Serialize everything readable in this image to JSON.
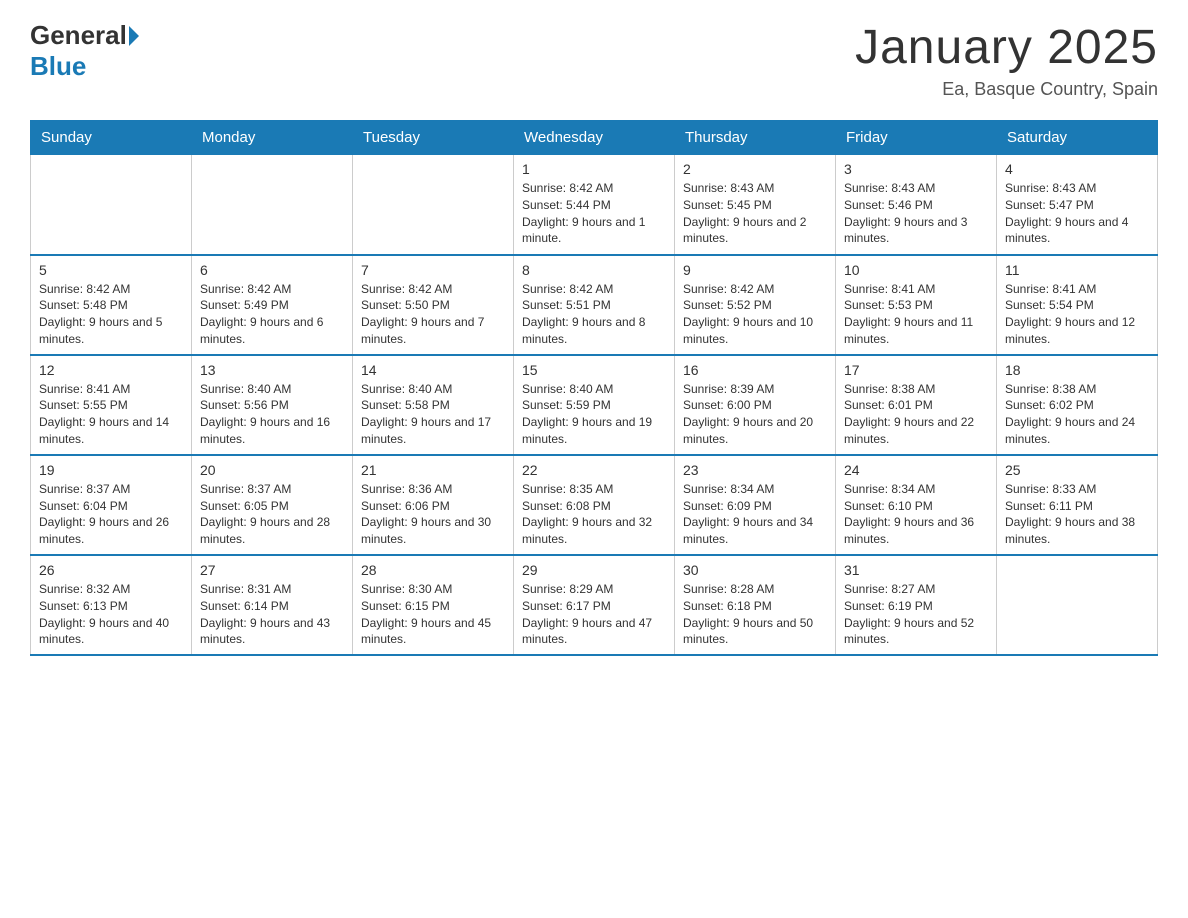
{
  "header": {
    "logo_general": "General",
    "logo_blue": "Blue",
    "title": "January 2025",
    "subtitle": "Ea, Basque Country, Spain"
  },
  "days_of_week": [
    "Sunday",
    "Monday",
    "Tuesday",
    "Wednesday",
    "Thursday",
    "Friday",
    "Saturday"
  ],
  "weeks": [
    [
      {
        "day": "",
        "info": ""
      },
      {
        "day": "",
        "info": ""
      },
      {
        "day": "",
        "info": ""
      },
      {
        "day": "1",
        "info": "Sunrise: 8:42 AM\nSunset: 5:44 PM\nDaylight: 9 hours and 1 minute."
      },
      {
        "day": "2",
        "info": "Sunrise: 8:43 AM\nSunset: 5:45 PM\nDaylight: 9 hours and 2 minutes."
      },
      {
        "day": "3",
        "info": "Sunrise: 8:43 AM\nSunset: 5:46 PM\nDaylight: 9 hours and 3 minutes."
      },
      {
        "day": "4",
        "info": "Sunrise: 8:43 AM\nSunset: 5:47 PM\nDaylight: 9 hours and 4 minutes."
      }
    ],
    [
      {
        "day": "5",
        "info": "Sunrise: 8:42 AM\nSunset: 5:48 PM\nDaylight: 9 hours and 5 minutes."
      },
      {
        "day": "6",
        "info": "Sunrise: 8:42 AM\nSunset: 5:49 PM\nDaylight: 9 hours and 6 minutes."
      },
      {
        "day": "7",
        "info": "Sunrise: 8:42 AM\nSunset: 5:50 PM\nDaylight: 9 hours and 7 minutes."
      },
      {
        "day": "8",
        "info": "Sunrise: 8:42 AM\nSunset: 5:51 PM\nDaylight: 9 hours and 8 minutes."
      },
      {
        "day": "9",
        "info": "Sunrise: 8:42 AM\nSunset: 5:52 PM\nDaylight: 9 hours and 10 minutes."
      },
      {
        "day": "10",
        "info": "Sunrise: 8:41 AM\nSunset: 5:53 PM\nDaylight: 9 hours and 11 minutes."
      },
      {
        "day": "11",
        "info": "Sunrise: 8:41 AM\nSunset: 5:54 PM\nDaylight: 9 hours and 12 minutes."
      }
    ],
    [
      {
        "day": "12",
        "info": "Sunrise: 8:41 AM\nSunset: 5:55 PM\nDaylight: 9 hours and 14 minutes."
      },
      {
        "day": "13",
        "info": "Sunrise: 8:40 AM\nSunset: 5:56 PM\nDaylight: 9 hours and 16 minutes."
      },
      {
        "day": "14",
        "info": "Sunrise: 8:40 AM\nSunset: 5:58 PM\nDaylight: 9 hours and 17 minutes."
      },
      {
        "day": "15",
        "info": "Sunrise: 8:40 AM\nSunset: 5:59 PM\nDaylight: 9 hours and 19 minutes."
      },
      {
        "day": "16",
        "info": "Sunrise: 8:39 AM\nSunset: 6:00 PM\nDaylight: 9 hours and 20 minutes."
      },
      {
        "day": "17",
        "info": "Sunrise: 8:38 AM\nSunset: 6:01 PM\nDaylight: 9 hours and 22 minutes."
      },
      {
        "day": "18",
        "info": "Sunrise: 8:38 AM\nSunset: 6:02 PM\nDaylight: 9 hours and 24 minutes."
      }
    ],
    [
      {
        "day": "19",
        "info": "Sunrise: 8:37 AM\nSunset: 6:04 PM\nDaylight: 9 hours and 26 minutes."
      },
      {
        "day": "20",
        "info": "Sunrise: 8:37 AM\nSunset: 6:05 PM\nDaylight: 9 hours and 28 minutes."
      },
      {
        "day": "21",
        "info": "Sunrise: 8:36 AM\nSunset: 6:06 PM\nDaylight: 9 hours and 30 minutes."
      },
      {
        "day": "22",
        "info": "Sunrise: 8:35 AM\nSunset: 6:08 PM\nDaylight: 9 hours and 32 minutes."
      },
      {
        "day": "23",
        "info": "Sunrise: 8:34 AM\nSunset: 6:09 PM\nDaylight: 9 hours and 34 minutes."
      },
      {
        "day": "24",
        "info": "Sunrise: 8:34 AM\nSunset: 6:10 PM\nDaylight: 9 hours and 36 minutes."
      },
      {
        "day": "25",
        "info": "Sunrise: 8:33 AM\nSunset: 6:11 PM\nDaylight: 9 hours and 38 minutes."
      }
    ],
    [
      {
        "day": "26",
        "info": "Sunrise: 8:32 AM\nSunset: 6:13 PM\nDaylight: 9 hours and 40 minutes."
      },
      {
        "day": "27",
        "info": "Sunrise: 8:31 AM\nSunset: 6:14 PM\nDaylight: 9 hours and 43 minutes."
      },
      {
        "day": "28",
        "info": "Sunrise: 8:30 AM\nSunset: 6:15 PM\nDaylight: 9 hours and 45 minutes."
      },
      {
        "day": "29",
        "info": "Sunrise: 8:29 AM\nSunset: 6:17 PM\nDaylight: 9 hours and 47 minutes."
      },
      {
        "day": "30",
        "info": "Sunrise: 8:28 AM\nSunset: 6:18 PM\nDaylight: 9 hours and 50 minutes."
      },
      {
        "day": "31",
        "info": "Sunrise: 8:27 AM\nSunset: 6:19 PM\nDaylight: 9 hours and 52 minutes."
      },
      {
        "day": "",
        "info": ""
      }
    ]
  ]
}
